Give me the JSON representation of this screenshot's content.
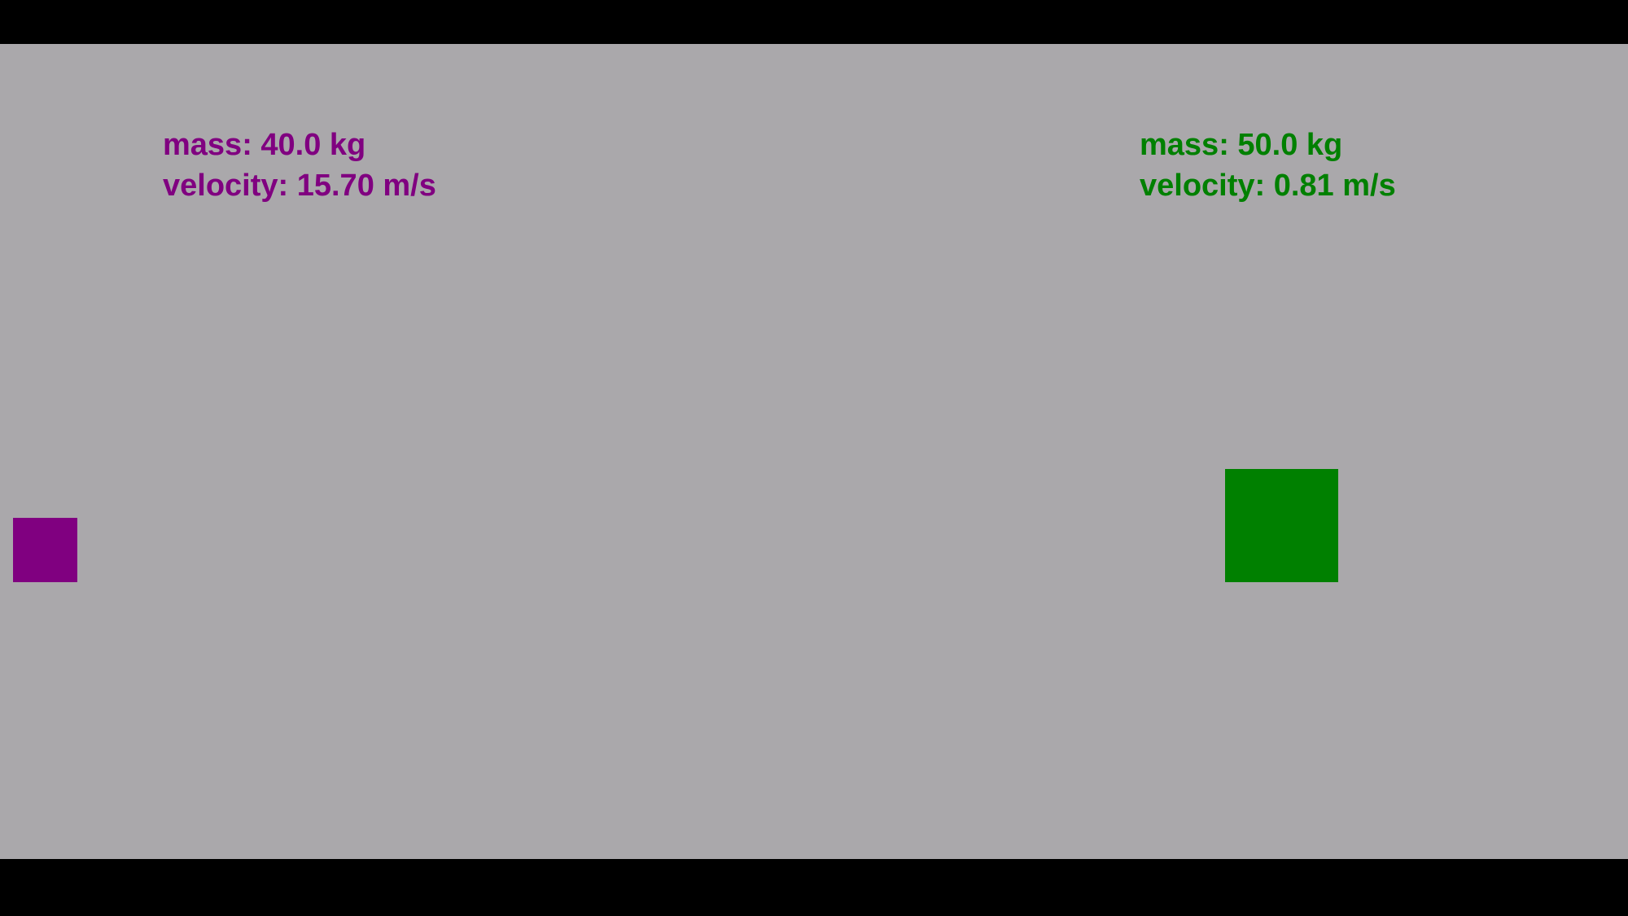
{
  "colors": {
    "background": "#aaa8ab",
    "letterbox": "#000000",
    "left_object": "#800080",
    "right_object": "#008000"
  },
  "left_object": {
    "mass_text": "mass: 40.0 kg",
    "velocity_text": "velocity: 15.70 m/s"
  },
  "right_object": {
    "mass_text": "mass: 50.0 kg",
    "velocity_text": "velocity: 0.81 m/s"
  }
}
